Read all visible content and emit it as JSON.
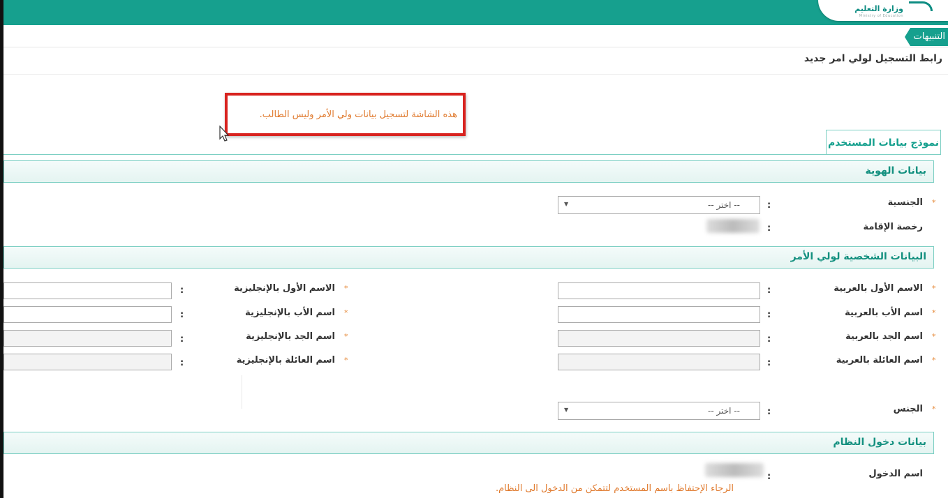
{
  "header": {
    "ministry_name": "وزارة التعليم",
    "ministry_sub": "Ministry of Education"
  },
  "notifications_tab": "التنبيهات",
  "page_title": "رابط التسجيل لولي امر جديد",
  "alert_message": "هذه الشاشة لتسجيل بيانات ولي الأمر وليس الطالب.",
  "form_tab": "نموذج بيانات المستخدم",
  "colon": ":",
  "required_mark": "*",
  "sections": {
    "identity": "بيانات الهوية",
    "personal": "البيانات الشخصية لولي الأمر",
    "login": "بيانات دخول النظام"
  },
  "identity": {
    "nationality_label": "الجنسية",
    "nationality_value": "-- اختر --",
    "residence_label": "رخصة الإقامة"
  },
  "personal": {
    "first_name_ar": "الاسم الأول بالعربية",
    "father_name_ar": "اسم الأب بالعربية",
    "grandfather_name_ar": "اسم الجد بالعربية",
    "family_name_ar": "اسم العائلة بالعربية",
    "first_name_en": "الاسم الأول بالإنجليزية",
    "father_name_en": "اسم الأب بالإنجليزية",
    "grandfather_name_en": "اسم الجد بالإنجليزية",
    "family_name_en": "اسم العائلة بالإنجليزية",
    "gender_label": "الجنس",
    "gender_value": "-- اختر --"
  },
  "login": {
    "username_label": "اسم الدخول",
    "hint": "الرجاء الإحتفاظ باسم المستخدم لتتمكن من الدخول الى النظام."
  },
  "colors": {
    "brand": "#16a08e",
    "alert_border": "#d8231f",
    "alert_text": "#e07a2e"
  }
}
